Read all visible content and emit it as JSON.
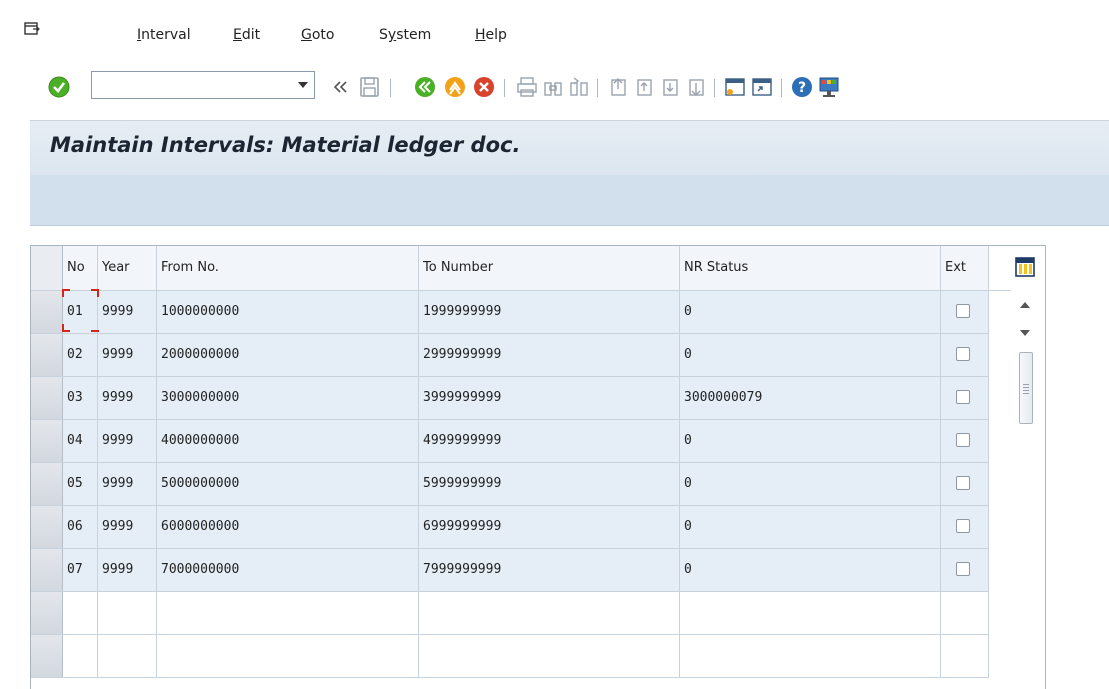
{
  "menu": {
    "items": [
      {
        "underline": "I",
        "rest": "nterval"
      },
      {
        "underline": "E",
        "rest": "dit"
      },
      {
        "underline": "G",
        "rest": "oto"
      },
      {
        "prefix": "S",
        "underline": "y",
        "rest": "stem"
      },
      {
        "underline": "H",
        "rest": "elp"
      }
    ]
  },
  "toolbar": {
    "command_value": "",
    "icons": [
      "enter-icon",
      "command-field",
      "back-double-icon",
      "save-icon",
      "back-icon",
      "exit-icon",
      "cancel-icon",
      "print-icon",
      "find-icon",
      "find-next-icon",
      "first-page-icon",
      "previous-page-icon",
      "next-page-icon",
      "last-page-icon",
      "new-session-icon",
      "shortcut-icon",
      "help-icon",
      "customize-layout-icon"
    ],
    "colors": {
      "green": "#4caf28",
      "orange": "#f4a11a",
      "red": "#d9432c",
      "help_blue": "#2d6fb6"
    }
  },
  "page_title": "Maintain Intervals: Material ledger doc.",
  "table": {
    "columns": [
      "No",
      "Year",
      "From No.",
      "To Number",
      "NR Status",
      "Ext"
    ],
    "rows": [
      {
        "no": "01",
        "year": "9999",
        "from": "1000000000",
        "to": "1999999999",
        "status": "0",
        "ext": false
      },
      {
        "no": "02",
        "year": "9999",
        "from": "2000000000",
        "to": "2999999999",
        "status": "0",
        "ext": false
      },
      {
        "no": "03",
        "year": "9999",
        "from": "3000000000",
        "to": "3999999999",
        "status": "3000000079",
        "ext": false
      },
      {
        "no": "04",
        "year": "9999",
        "from": "4000000000",
        "to": "4999999999",
        "status": "0",
        "ext": false
      },
      {
        "no": "05",
        "year": "9999",
        "from": "5000000000",
        "to": "5999999999",
        "status": "0",
        "ext": false
      },
      {
        "no": "06",
        "year": "9999",
        "from": "6000000000",
        "to": "6999999999",
        "status": "0",
        "ext": false
      },
      {
        "no": "07",
        "year": "9999",
        "from": "7000000000",
        "to": "7999999999",
        "status": "0",
        "ext": false
      }
    ],
    "empty_rows": 2
  }
}
